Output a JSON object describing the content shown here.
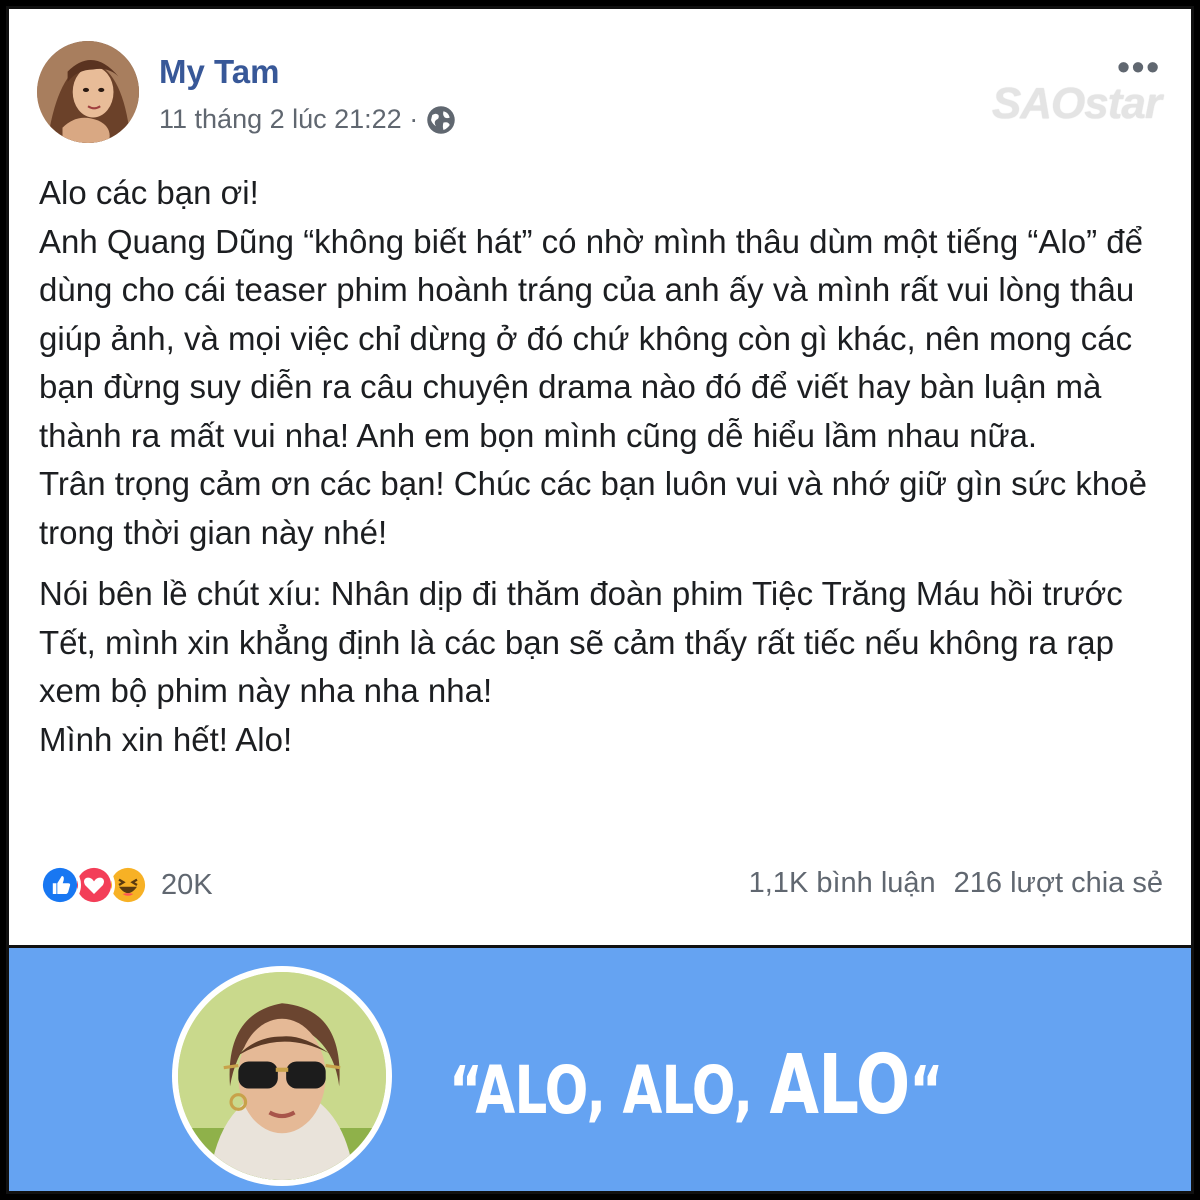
{
  "post": {
    "author": "My Tam",
    "timestamp": "11 tháng 2 lúc 21:22 ·",
    "watermark": "SAOstar",
    "more_label": "•••",
    "paragraphs": [
      "Alo các bạn ơi!",
      "Anh Quang Dũng “không biết hát” có nhờ mình thâu dùm một tiếng “Alo” để dùng cho cái teaser phim hoành tráng của anh ấy và mình rất vui lòng thâu giúp ảnh, và mọi việc chỉ dừng ở đó chứ không còn gì khác, nên mong các bạn đừng suy diễn ra câu chuyện drama nào đó để viết hay bàn luận mà thành ra mất vui nha! Anh em bọn mình cũng dễ hiểu lầm nhau nữa.",
      "Trân trọng cảm ơn các bạn! Chúc các bạn luôn vui và nhớ giữ gìn sức khoẻ trong thời gian này nhé!",
      "Nói bên lề chút xíu: Nhân dịp đi thăm đoàn phim Tiệc Trăng Máu hồi trước Tết, mình xin khẳng định là các bạn sẽ cảm thấy rất tiếc nếu không ra rạp xem bộ phim này nha nha nha!",
      "Mình xin hết! Alo!"
    ],
    "reactions": {
      "icons": [
        "like-icon",
        "love-icon",
        "haha-icon"
      ],
      "count": "20K"
    },
    "comments": "1,1K bình luận",
    "shares": "216 lượt chia sẻ",
    "colors": {
      "author": "#385898",
      "meta": "#606770",
      "like": "#1877f2",
      "love": "#f33e58",
      "haha": "#f7b125"
    }
  },
  "banner": {
    "quote_open": "“ALO, ALO, ",
    "quote_big": "ALO",
    "quote_close": "“",
    "background": "#65a3f2"
  }
}
